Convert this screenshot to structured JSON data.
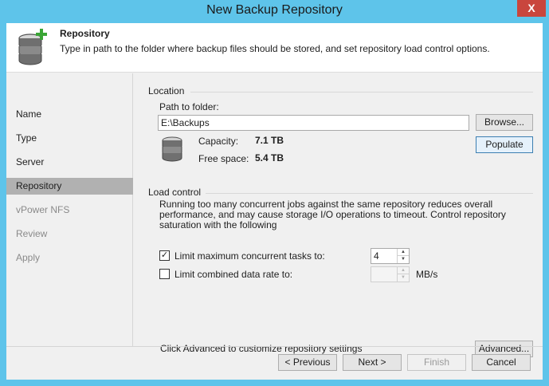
{
  "window": {
    "title": "New Backup Repository",
    "close_glyph": "X"
  },
  "header": {
    "title": "Repository",
    "description": "Type in path to the folder where backup files should be stored, and set repository load control options.",
    "icon": "database-add-icon"
  },
  "sidebar": {
    "items": [
      {
        "label": "Name",
        "state": "enabled"
      },
      {
        "label": "Type",
        "state": "enabled"
      },
      {
        "label": "Server",
        "state": "enabled"
      },
      {
        "label": "Repository",
        "state": "active"
      },
      {
        "label": "vPower NFS",
        "state": "disabled"
      },
      {
        "label": "Review",
        "state": "disabled"
      },
      {
        "label": "Apply",
        "state": "disabled"
      }
    ]
  },
  "location": {
    "group_label": "Location",
    "path_label": "Path to folder:",
    "path_value": "E:\\Backups",
    "browse_label": "Browse...",
    "populate_label": "Populate",
    "capacity_label": "Capacity:",
    "capacity_value": "7.1 TB",
    "free_label": "Free space:",
    "free_value": "5.4 TB",
    "icon": "database-icon"
  },
  "load_control": {
    "group_label": "Load control",
    "description": "Running too many concurrent jobs against the same repository reduces overall performance, and may cause storage I/O operations to timeout. Control repository saturation with the following",
    "limit_tasks_label": "Limit maximum concurrent tasks to:",
    "limit_tasks_checked": true,
    "limit_tasks_value": "4",
    "limit_rate_label": "Limit combined data rate to:",
    "limit_rate_checked": false,
    "limit_rate_value": "",
    "rate_unit": "MB/s",
    "check_glyph": "✓"
  },
  "advanced": {
    "hint": "Click Advanced to customize repository settings",
    "button_label": "Advanced..."
  },
  "footer": {
    "previous_label": "< Previous",
    "next_label": "Next >",
    "finish_label": "Finish",
    "cancel_label": "Cancel"
  },
  "colors": {
    "title_bar": "#5ec4ea",
    "close_button": "#c9463d",
    "active_nav": "#b1b1b1"
  }
}
